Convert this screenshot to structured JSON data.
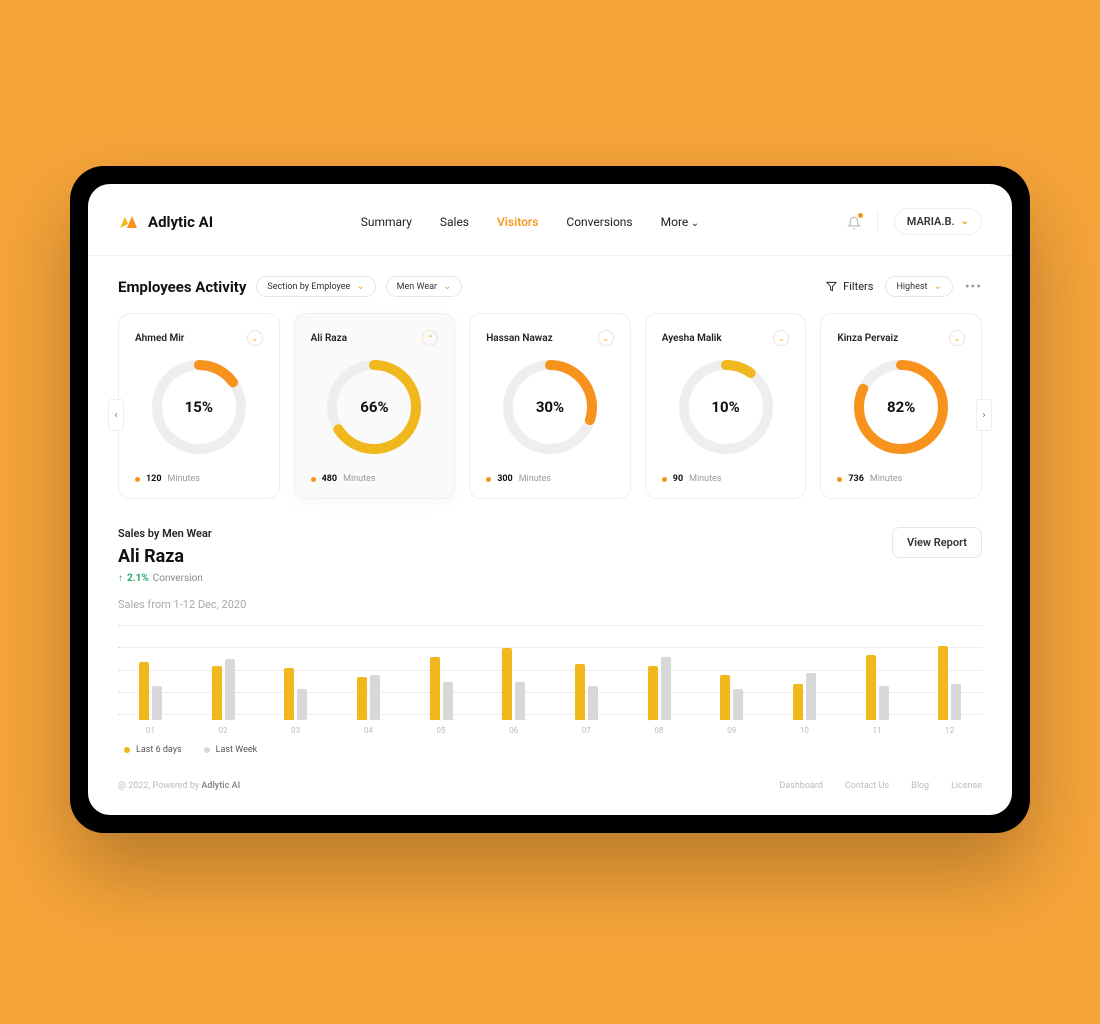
{
  "brand": {
    "name": "Adlytic AI"
  },
  "nav": {
    "items": [
      "Summary",
      "Sales",
      "Visitors",
      "Conversions",
      "More"
    ],
    "active_index": 2
  },
  "header": {
    "user": "MARIA.B."
  },
  "controls": {
    "title": "Employees Activity",
    "filter1": "Section by Employee",
    "filter2": "Men Wear",
    "filters_label": "Filters",
    "sort_label": "Highest"
  },
  "employees": [
    {
      "name": "Ahmed Mir",
      "percent": 15,
      "minutes": 120,
      "minutes_label": "Minutes",
      "ring_color": "#f7931d",
      "expanded": false
    },
    {
      "name": "Ali Raza",
      "percent": 66,
      "minutes": 480,
      "minutes_label": "Minutes",
      "ring_color": "#f1b81d",
      "expanded": true
    },
    {
      "name": "Hassan Nawaz",
      "percent": 30,
      "minutes": 300,
      "minutes_label": "Minutes",
      "ring_color": "#f7931d",
      "expanded": false
    },
    {
      "name": "Ayesha Malik",
      "percent": 10,
      "minutes": 90,
      "minutes_label": "Minutes",
      "ring_color": "#f1b81d",
      "expanded": false
    },
    {
      "name": "Kinza Pervaiz",
      "percent": 82,
      "minutes": 736,
      "minutes_label": "Minutes",
      "ring_color": "#f7931d",
      "expanded": false
    }
  ],
  "sales": {
    "subtitle": "Sales by Men Wear",
    "person": "Ali Raza",
    "conversion_pct": "2.1%",
    "conversion_label": "Conversion",
    "view_report": "View Report",
    "range": "Sales from 1-12 Dec, 2020",
    "legend": {
      "a": "Last 6 days",
      "b": "Last Week"
    }
  },
  "chart_data": {
    "type": "bar",
    "categories": [
      "01",
      "02",
      "03",
      "04",
      "05",
      "06",
      "07",
      "08",
      "09",
      "10",
      "11",
      "12"
    ],
    "series": [
      {
        "name": "Last 6 days",
        "color": "#f1b81d",
        "values": [
          65,
          60,
          58,
          48,
          70,
          80,
          62,
          60,
          50,
          40,
          72,
          82
        ]
      },
      {
        "name": "Last Week",
        "color": "#d8d8d8",
        "values": [
          38,
          68,
          35,
          50,
          42,
          42,
          38,
          70,
          35,
          52,
          38,
          40
        ]
      }
    ],
    "title": "Sales by Men Wear — Ali Raza",
    "xlabel": "",
    "ylabel": "",
    "ylim": [
      0,
      100
    ]
  },
  "footer": {
    "copyright_prefix": "@ 2022, Powered by ",
    "copyright_brand": "Adlytic AI",
    "links": [
      "Dashboard",
      "Contact Us",
      "Blog",
      "License"
    ]
  }
}
